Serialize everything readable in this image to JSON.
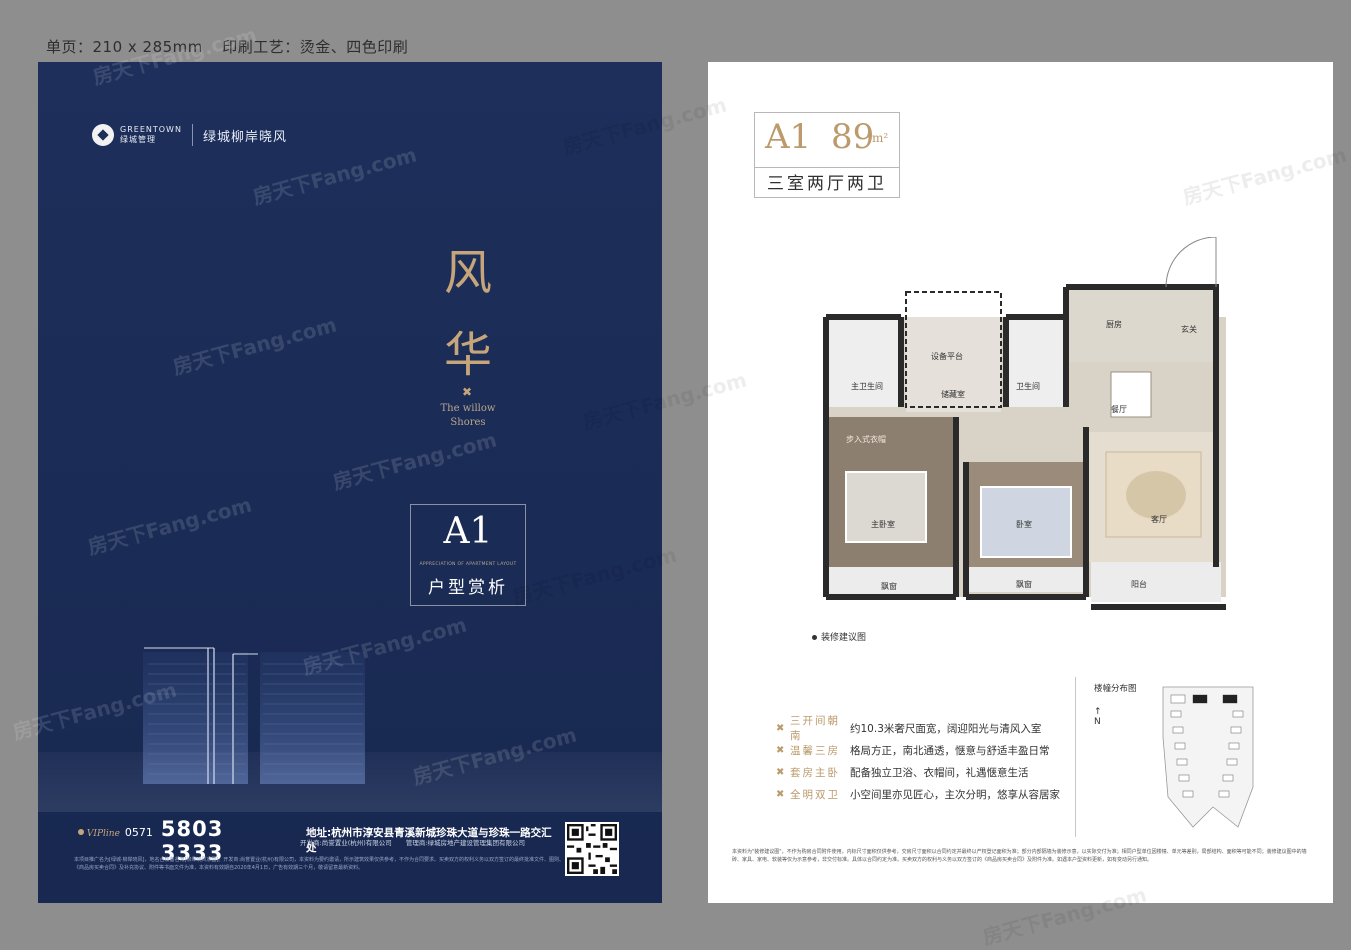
{
  "spec_line": {
    "size": "单页：210 x 285mm",
    "process": "印刷工艺：烫金、四色印刷"
  },
  "left": {
    "brand": {
      "logo_en": "GREENTOWN",
      "logo_cn": "绿城管理",
      "project": "绿城柳岸晓风"
    },
    "title_chars": [
      "风",
      "华"
    ],
    "willow_line1": "The willow",
    "willow_line2": "Shores",
    "a1_code": "A1",
    "a1_en": "APPRECIATION OF APARTMENT LAYOUT",
    "a1_cn": "户型赏析",
    "contact": {
      "vip_label": "VIPline",
      "area_code": "0571",
      "phone": "5803 3333",
      "address": "地址:杭州市淳安县青溪新城珍珠大道与珍珠一路交汇处",
      "developer": "开发商:尚誉置业(杭州)有限公司",
      "manager": "管理商:绿城房地产建设管理集团有限公司"
    },
    "legal_text": "本项目推广名为[绿城·柳岸晓风]，地名合核备名为[柳岸晓风家园]。开发商:尚誉置业(杭州)有限公司，本资料为要约邀请，所示建筑效果仅供参考，不作为合同要求。买卖双方的权利义务以双方签订的最终批准文件、图则、《商品房买卖合同》及补充协议、附件等书面文件为准，本资料有效期自2020年4月1日，广告有效期三个月，敬请留意最新资料。"
  },
  "right": {
    "unit": {
      "code": "A1",
      "area": "89",
      "area_unit": "m²",
      "rooms": "三室两厅两卫"
    },
    "plan_labels": {
      "kitchen": "厨房",
      "entry": "玄关",
      "equipment": "设备平台",
      "storage": "储藏室",
      "master_bath": "主卫生间",
      "second_bath": "卫生间",
      "dining": "餐厅",
      "walkin": "步入式衣帽",
      "master_bed": "主卧室",
      "bedroom": "卧室",
      "living": "客厅",
      "balcony": "阳台",
      "bay1": "飘窗",
      "bay2": "飘窗"
    },
    "deco_note": "装修建议图",
    "features": [
      {
        "title": "三开间朝南",
        "desc": "约10.3米奢尺面宽，阔迎阳光与清风入室"
      },
      {
        "title": "温馨三房",
        "desc": "格局方正，南北通透，惬意与舒适丰盈日常"
      },
      {
        "title": "套房主卧",
        "desc": "配备独立卫浴、衣帽间，礼遇惬意生活"
      },
      {
        "title": "全明双卫",
        "desc": "小空间里亦见匠心，主次分明，悠享从容居家"
      }
    ],
    "site_plan_label": "楼幢分布图",
    "north": "N",
    "footnote": "本资料为\"装修建议图\"，不作为购房合同附件使用，内标尺寸面积仅供参考，交房尺寸面积以合同约定并最终以产权登记面积为准；部分内部隔墙为装修示意，以实际交付为准；相同户型单位因楼幢、单元等差别，局部结构、面积等可能不同；装修建议图中的墙砖、家具、家电、软装等仅为示意参考，非交付标准。具体以合同约定为准。买卖双方的权利与义务以双方签订的《商品房买卖合同》及附件为准。如遇本户型资料更新，如有变动另行通知。"
  },
  "watermark": "房天下Fang.com",
  "colors": {
    "navy": "#1d2f5a",
    "gold": "#c7a57a",
    "gold_dark": "#bb9a6b",
    "paper": "#ffffff",
    "frame": "#8e8e8e"
  }
}
